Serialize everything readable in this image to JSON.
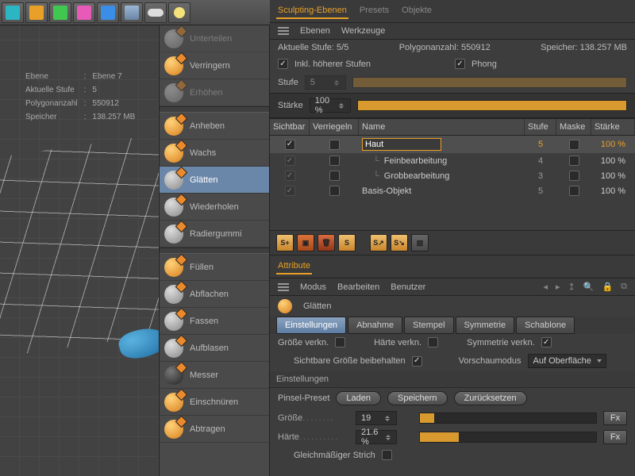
{
  "top_toolbar_icons": [
    "cube",
    "torus",
    "array",
    "emitter",
    "deformer",
    "grid",
    "render",
    "light"
  ],
  "hud": {
    "ebene_lbl": "Ebene",
    "ebene_val": "Ebene 7",
    "stufe_lbl": "Aktuelle Stufe",
    "stufe_val": "5",
    "poly_lbl": "Polygonanzahl",
    "poly_val": "550912",
    "mem_lbl": "Speicher",
    "mem_val": "138.257 MB"
  },
  "tools": [
    {
      "label": "Unterteilen",
      "cls": "gray dim"
    },
    {
      "label": "Verringern",
      "cls": ""
    },
    {
      "label": "Erhöhen",
      "cls": "gray dim"
    },
    {
      "label": "Anheben",
      "cls": ""
    },
    {
      "label": "Wachs",
      "cls": ""
    },
    {
      "label": "Glätten",
      "cls": "gray selected"
    },
    {
      "label": "Wiederholen",
      "cls": "gray"
    },
    {
      "label": "Radiergummi",
      "cls": "gray"
    },
    {
      "label": "Füllen",
      "cls": ""
    },
    {
      "label": "Abflachen",
      "cls": "gray"
    },
    {
      "label": "Fassen",
      "cls": "gray"
    },
    {
      "label": "Aufblasen",
      "cls": "gray"
    },
    {
      "label": "Messer",
      "cls": "dark"
    },
    {
      "label": "Einschnüren",
      "cls": ""
    },
    {
      "label": "Abtragen",
      "cls": ""
    }
  ],
  "main_tabs": {
    "a": "Sculpting-Ebenen",
    "b": "Presets",
    "c": "Objekte"
  },
  "sub_tabs": {
    "a": "Ebenen",
    "b": "Werkzeuge"
  },
  "statusline": {
    "stufe_lbl": "Aktuelle Stufe:",
    "stufe_val": "5/5",
    "poly_lbl": "Polygonanzahl:",
    "poly_val": "550912",
    "mem_lbl": "Speicher:",
    "mem_val": "138.257 MB"
  },
  "opts": {
    "inkl": "Inkl. höherer Stufen",
    "phong": "Phong",
    "stufe_lbl": "Stufe",
    "stufe_val": "5",
    "staerke_lbl": "Stärke",
    "staerke_val": "100 %"
  },
  "layer_headers": {
    "sichtbar": "Sichtbar",
    "verr": "Verriegeln",
    "name": "Name",
    "stufe": "Stufe",
    "maske": "Maske",
    "staerke": "Stärke"
  },
  "layers": [
    {
      "name": "Haut",
      "level": "5",
      "strength": "100 %",
      "sel": true,
      "input": true,
      "indent": false
    },
    {
      "name": "Feinbearbeitung",
      "level": "4",
      "strength": "100 %",
      "sel": false,
      "input": false,
      "indent": true
    },
    {
      "name": "Grobbearbeitung",
      "level": "3",
      "strength": "100 %",
      "sel": false,
      "input": false,
      "indent": true
    },
    {
      "name": "Basis-Objekt",
      "level": "5",
      "strength": "100 %",
      "sel": false,
      "input": false,
      "indent": false
    }
  ],
  "attribute_tab": "Attribute",
  "attr_menu": {
    "modus": "Modus",
    "bearb": "Bearbeiten",
    "benutzer": "Benutzer"
  },
  "attr_title": "Glätten",
  "attr_tabs": {
    "a": "Einstellungen",
    "b": "Abnahme",
    "c": "Stempel",
    "d": "Symmetrie",
    "e": "Schablone"
  },
  "attr_checks": {
    "g_verkn": "Größe verkn.",
    "h_verkn": "Härte verkn.",
    "s_verkn": "Symmetrie verkn.",
    "sicht": "Sichtbare Größe beibehalten",
    "vorschau_lbl": "Vorschaumodus",
    "vorschau_val": "Auf Oberfläche"
  },
  "einst_head": "Einstellungen",
  "preset": {
    "lbl": "Pinsel-Preset",
    "laden": "Laden",
    "speichern": "Speichern",
    "reset": "Zurücksetzen"
  },
  "sliders": {
    "groesse_lbl": "Größe",
    "groesse_val": "19",
    "groesse_pct": 8,
    "haerte_lbl": "Härte",
    "haerte_val": "21.6 %",
    "haerte_pct": 22,
    "fx": "Fx"
  },
  "gleich": "Gleichmäßiger Strich"
}
